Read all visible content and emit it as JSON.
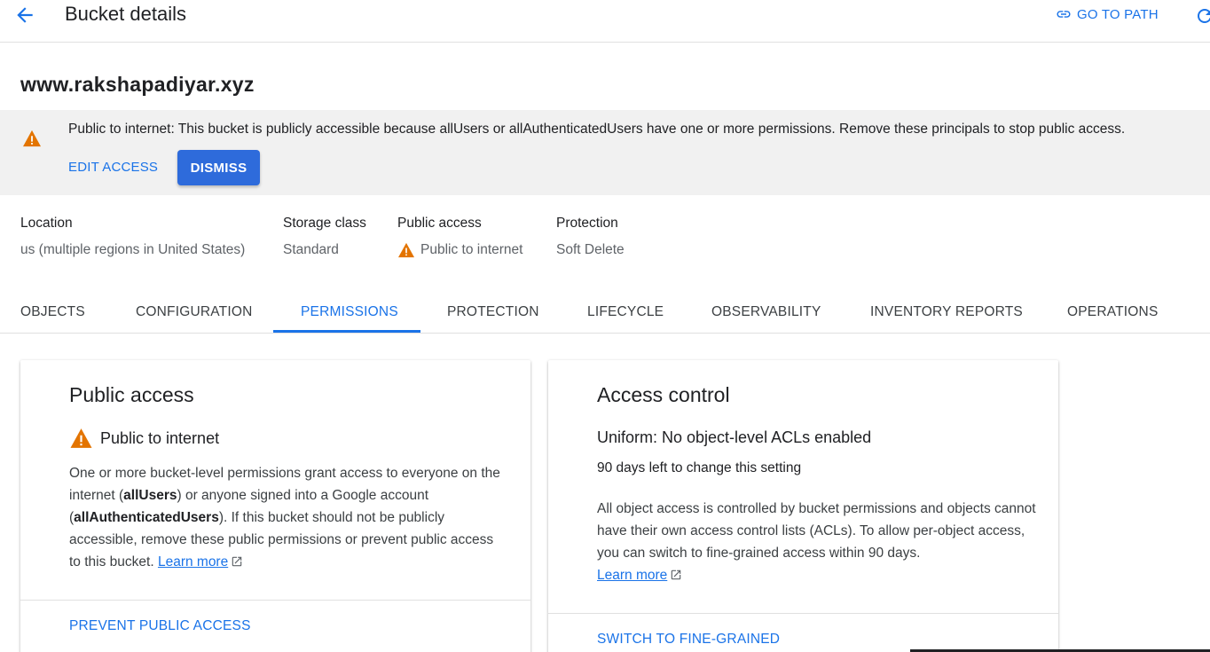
{
  "header": {
    "back_icon": "arrow-back-icon",
    "title": "Bucket details",
    "go_to_path_label": "GO TO PATH",
    "go_to_path_icon": "link-icon",
    "refresh_icon": "refresh-icon"
  },
  "bucket": {
    "name": "www.rakshapadiyar.xyz"
  },
  "banner": {
    "icon": "warning-icon",
    "bold_text": "Public to internet",
    "message": ": This bucket is publicly accessible because allUsers or allAuthenticatedUsers have one or more permissions. Remove these principals to stop public access.",
    "edit_access_label": "EDIT ACCESS",
    "dismiss_label": "DISMISS"
  },
  "info": {
    "location": {
      "label": "Location",
      "value": "us (multiple regions in United States)"
    },
    "storage_class": {
      "label": "Storage class",
      "value": "Standard"
    },
    "public_access": {
      "label": "Public access",
      "value": "Public to internet",
      "icon": "warning-icon"
    },
    "protection": {
      "label": "Protection",
      "value": "Soft Delete"
    }
  },
  "tabs": [
    {
      "label": "OBJECTS"
    },
    {
      "label": "CONFIGURATION"
    },
    {
      "label": "PERMISSIONS",
      "active": true
    },
    {
      "label": "PROTECTION"
    },
    {
      "label": "LIFECYCLE"
    },
    {
      "label": "OBSERVABILITY"
    },
    {
      "label": "INVENTORY REPORTS"
    },
    {
      "label": "OPERATIONS"
    }
  ],
  "public_access_card": {
    "title": "Public access",
    "status_icon": "warning-icon",
    "status": "Public to internet",
    "body_1": "One or more bucket-level permissions grant access to everyone on the internet (",
    "body_bold_1": "allUsers",
    "body_2": ") or anyone signed into a Google account (",
    "body_bold_2": "allAuthenticatedUsers",
    "body_3": "). If this bucket should not be publicly accessible, remove these public permissions or prevent public access to this bucket. ",
    "learn_more": "Learn more",
    "action_label": "PREVENT PUBLIC ACCESS"
  },
  "access_control_card": {
    "title": "Access control",
    "status": "Uniform: No object-level ACLs enabled",
    "days_left": "90 days left to change this setting",
    "body": "All object access is controlled by bucket permissions and objects cannot have their own access control lists (ACLs). To allow per-object access, you can switch to fine-grained access within 90 days.",
    "learn_more": "Learn more",
    "action_label": "SWITCH TO FINE-GRAINED"
  },
  "colors": {
    "accent": "#1a73e8",
    "button": "#2e6bdb",
    "warning": "#e37400",
    "banner_bg": "#f1f1f1"
  }
}
